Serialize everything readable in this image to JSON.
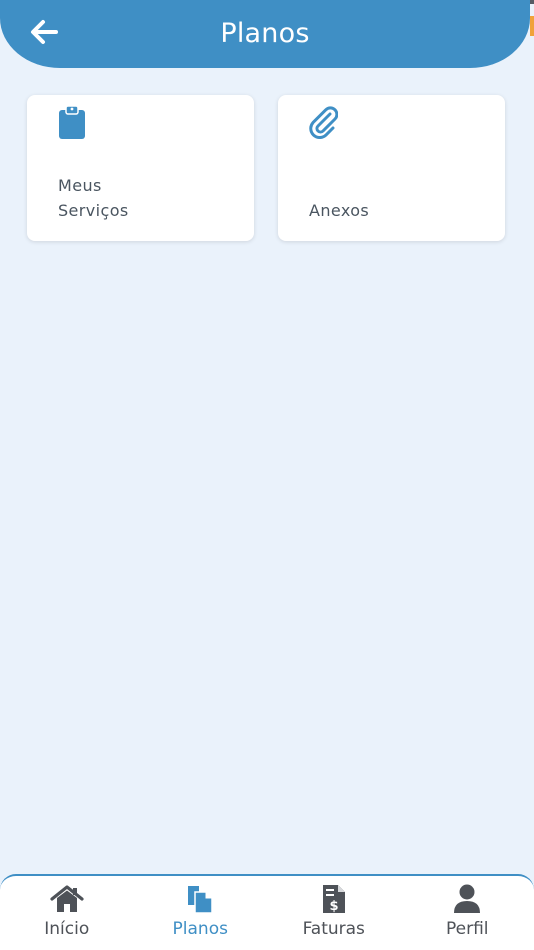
{
  "header": {
    "title": "Planos",
    "back_icon": "arrow-left-icon"
  },
  "colors": {
    "primary": "#3f8fc5",
    "background": "#eaf2fb",
    "icon_dark": "#4e5258"
  },
  "cards": [
    {
      "label_line1": "Meus",
      "label_line2": "Serviços",
      "icon": "clipboard-icon"
    },
    {
      "label_line1": "",
      "label_line2": "Anexos",
      "icon": "paperclip-icon"
    }
  ],
  "bottom_nav": {
    "items": [
      {
        "label": "Início",
        "icon": "home-icon",
        "active": false
      },
      {
        "label": "Planos",
        "icon": "documents-icon",
        "active": true
      },
      {
        "label": "Faturas",
        "icon": "invoice-icon",
        "active": false
      },
      {
        "label": "Perfil",
        "icon": "user-icon",
        "active": false
      }
    ]
  }
}
